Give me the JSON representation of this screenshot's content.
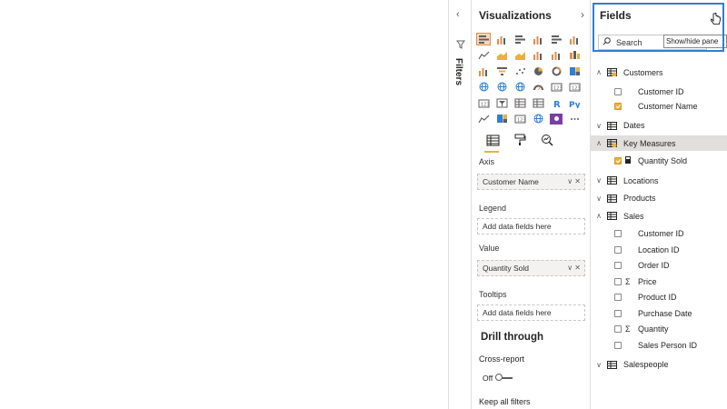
{
  "filters": {
    "label": "Filters"
  },
  "visualizations": {
    "title": "Visualizations",
    "icons": [
      "stacked-bar-icon",
      "stacked-column-icon",
      "clustered-bar-icon",
      "clustered-column-icon",
      "100-bar-icon",
      "100-column-icon",
      "line-chart-icon",
      "area-chart-icon",
      "stacked-area-icon",
      "line-column-icon",
      "line-clustered-column-icon",
      "ribbon-chart-icon",
      "waterfall-icon",
      "funnel-icon",
      "scatter-icon",
      "pie-icon",
      "donut-icon",
      "treemap-icon",
      "map-icon",
      "filled-map-icon",
      "shape-map-icon",
      "gauge-icon",
      "card-icon",
      "multirow-card-icon",
      "kpi-icon",
      "slicer-icon",
      "table-icon",
      "matrix-icon",
      "r-visual-icon",
      "python-visual-icon",
      "key-influencers-icon",
      "decomposition-tree-icon",
      "qa-icon",
      "arcgis-icon",
      "custom-visual-icon",
      "more-visuals-icon"
    ],
    "selected_index": 0,
    "axis_label": "Axis",
    "axis_value": "Customer Name",
    "legend_label": "Legend",
    "legend_placeholder": "Add data fields here",
    "value_label": "Value",
    "value_value": "Quantity Sold",
    "tooltips_label": "Tooltips",
    "tooltips_placeholder": "Add data fields here",
    "drill_title": "Drill through",
    "cross_report_label": "Cross-report",
    "cross_report_state": "Off",
    "keep_filters_label": "Keep all filters",
    "accent_color": "#e8b13c"
  },
  "fields": {
    "title": "Fields",
    "search_placeholder": "Search",
    "tooltip": "Show/hide pane",
    "highlight_color": "#2f7fd4",
    "tables": [
      {
        "name": "Customers",
        "expanded": true,
        "has_selection": true,
        "fields": [
          {
            "name": "Customer ID",
            "checked": false,
            "sigma": false
          },
          {
            "name": "Customer Name",
            "checked": true,
            "sigma": false
          }
        ]
      },
      {
        "name": "Dates",
        "expanded": false,
        "has_selection": false,
        "fields": []
      },
      {
        "name": "Key Measures",
        "expanded": true,
        "has_selection": true,
        "highlighted": true,
        "fields": [
          {
            "name": "Quantity Sold",
            "checked": true,
            "sigma": false,
            "measure": true
          }
        ]
      },
      {
        "name": "Locations",
        "expanded": false,
        "has_selection": false,
        "fields": []
      },
      {
        "name": "Products",
        "expanded": false,
        "has_selection": false,
        "fields": []
      },
      {
        "name": "Sales",
        "expanded": true,
        "has_selection": false,
        "fields": [
          {
            "name": "Customer ID",
            "checked": false,
            "sigma": false
          },
          {
            "name": "Location ID",
            "checked": false,
            "sigma": false
          },
          {
            "name": "Order ID",
            "checked": false,
            "sigma": false
          },
          {
            "name": "Price",
            "checked": false,
            "sigma": true
          },
          {
            "name": "Product ID",
            "checked": false,
            "sigma": false
          },
          {
            "name": "Purchase Date",
            "checked": false,
            "sigma": false
          },
          {
            "name": "Quantity",
            "checked": false,
            "sigma": true
          },
          {
            "name": "Sales Person ID",
            "checked": false,
            "sigma": false
          }
        ]
      },
      {
        "name": "Salespeople",
        "expanded": false,
        "has_selection": false,
        "fields": []
      }
    ]
  }
}
